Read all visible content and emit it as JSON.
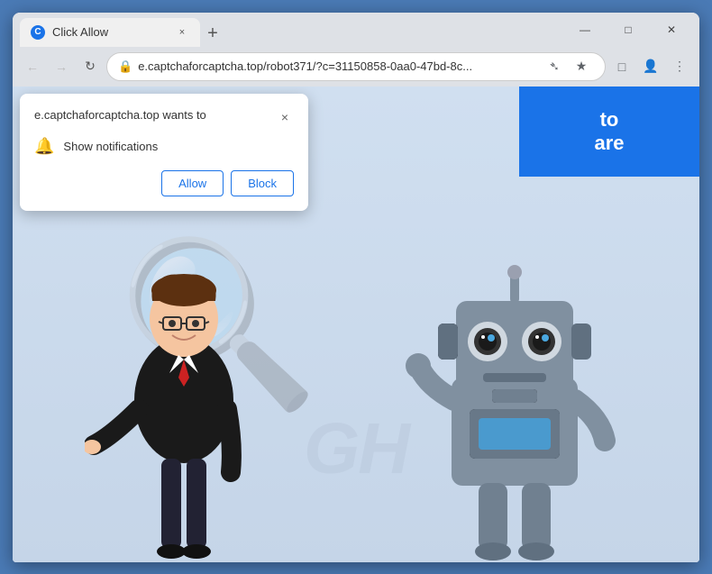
{
  "window": {
    "title": "Click Allow",
    "favicon": "C"
  },
  "tab": {
    "label": "Click Allow",
    "close_icon": "×"
  },
  "controls": {
    "minimize": "—",
    "maximize": "□",
    "close": "×",
    "new_tab": "+"
  },
  "nav": {
    "back": "←",
    "forward": "→",
    "refresh": "↻",
    "url": "e.captchaforcaptcha.top/robot371/?c=31150858-0aa0-47bd-8c...",
    "lock_icon": "🔒",
    "share_icon": "⎋",
    "bookmark_icon": "☆",
    "extensions_icon": "□",
    "profile_icon": "👤",
    "menu_icon": "⋮"
  },
  "permission_popup": {
    "site": "e.captchaforcaptcha.top wants to",
    "permission": "Show notifications",
    "allow_label": "Allow",
    "block_label": "Block",
    "close_icon": "×"
  },
  "website": {
    "banner_line1": "to",
    "banner_line2": "are",
    "watermark": "GH"
  }
}
